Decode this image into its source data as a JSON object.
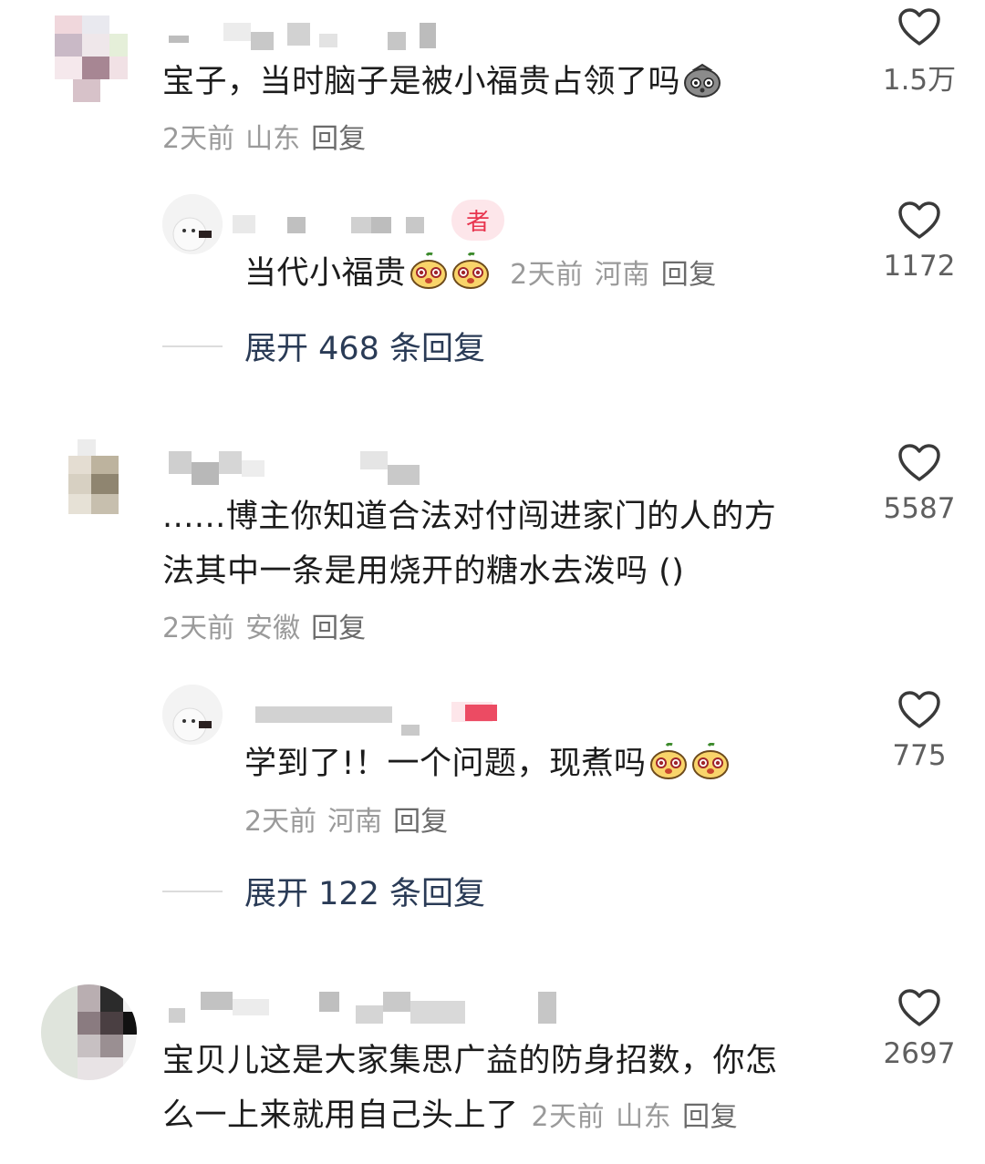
{
  "comments": [
    {
      "text": "宝子，当时脑子是被小福贵占领了吗",
      "time": "2天前",
      "location": "山东",
      "reply": "回复",
      "likes": "1.5万",
      "sub": {
        "tag": "者",
        "text": "当代小福贵",
        "time": "2天前",
        "location": "河南",
        "reply": "回复",
        "likes": "1172"
      },
      "expand": "展开 468 条回复"
    },
    {
      "text_line1": "......博主你知道合法对付闯进家门的人的方",
      "text_line2": "法其中一条是用烧开的糖水去泼吗 ()",
      "time": "2天前",
      "location": "安徽",
      "reply": "回复",
      "likes": "5587",
      "sub": {
        "text": "学到了!！一个问题，现煮吗",
        "time": "2天前",
        "location": "河南",
        "reply": "回复",
        "likes": "775"
      },
      "expand": "展开 122 条回复"
    },
    {
      "text_line1": "宝贝儿这是大家集思广益的防身招数，你怎",
      "text_line2": "么一上来就用自己头上了",
      "time": "2天前",
      "location": "山东",
      "reply": "回复",
      "likes": "2697"
    }
  ],
  "icons": {
    "like": "heart-outline-icon",
    "emoji_face": "pear-face-emoji",
    "emoji_sack": "sack-face-emoji"
  },
  "colors": {
    "tag_bg": "#fde6ea",
    "tag_text": "#e8354f",
    "expand_text": "#2a3b56"
  }
}
